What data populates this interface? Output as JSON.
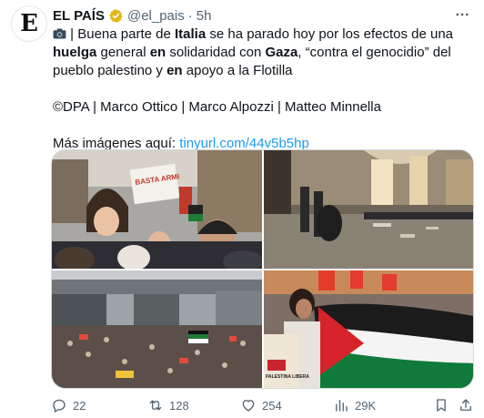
{
  "author": {
    "avatar_letter": "E",
    "name": "EL PAÍS",
    "handle": "@el_pais",
    "separator": "·",
    "time": "5h",
    "verified_color": "#e2b719"
  },
  "tweet": {
    "line1_parts": [
      {
        "text": " | Buena parte de ",
        "bold": false
      },
      {
        "text": "Italia",
        "bold": true
      },
      {
        "text": " se ha parado hoy por los efectos de una ",
        "bold": false
      },
      {
        "text": "huelga",
        "bold": true
      },
      {
        "text": " general ",
        "bold": false
      },
      {
        "text": "en",
        "bold": true
      },
      {
        "text": " solidaridad con ",
        "bold": false
      },
      {
        "text": "Gaza",
        "bold": true
      },
      {
        "text": ", “contra el genocidio” del pueblo palestino y ",
        "bold": false
      },
      {
        "text": "en",
        "bold": true
      },
      {
        "text": " apoyo a la Flotilla",
        "bold": false
      }
    ],
    "credits": "©DPA | Marco Ottico | Marco Alpozzi | Matteo Minnella",
    "more_images_label": "Más imágenes aquí: ",
    "link_text": "tinyurl.com/44v5b5hp",
    "link_color": "#1d9bf0"
  },
  "images": [
    {
      "name": "protest-crowd-banner-photo",
      "sign_text": "BASTA ARMI"
    },
    {
      "name": "station-riot-police-photo"
    },
    {
      "name": "aerial-march-photo"
    },
    {
      "name": "palestinian-flag-photo",
      "sign_text": "PALESTINA LIBERA"
    }
  ],
  "actions": {
    "replies": "22",
    "reposts": "128",
    "likes": "254",
    "views": "29K"
  },
  "colors": {
    "muted": "#536471",
    "text": "#0f1419",
    "border": "#cfd9de"
  }
}
